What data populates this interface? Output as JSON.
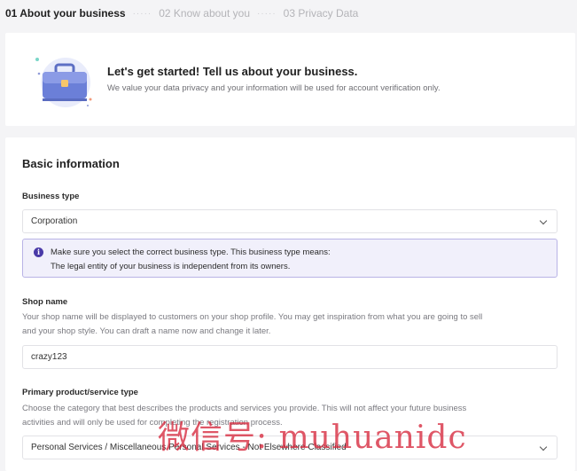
{
  "stepper": {
    "steps": [
      {
        "label": "01 About your business"
      },
      {
        "label": "02 Know about you"
      },
      {
        "label": "03 Privacy Data"
      }
    ],
    "separator": "·····"
  },
  "intro": {
    "title": "Let's get started! Tell us about your business.",
    "subtitle": "We value your data privacy and your information will be used for account verification only.",
    "illustration": "briefcase-icon"
  },
  "form": {
    "section_title": "Basic information",
    "business_type": {
      "label": "Business type",
      "value": "Corporation"
    },
    "notice": {
      "line1": "Make sure you select the correct business type. This business type means:",
      "line2": "The legal entity of your business is independent from its owners.",
      "icon": "info-icon"
    },
    "shop_name": {
      "label": "Shop name",
      "help_line1": "Your shop name will be displayed to customers on your shop profile. You may get inspiration from what you are going to sell",
      "help_line2": "and your shop style. You can draft a name now and change it later.",
      "value": "crazy123"
    },
    "product_type": {
      "label": "Primary product/service type",
      "help_line1": "Choose the category that best describes the products and services you provide. This will not affect your future business",
      "help_line2": "activities and will only be used for completing the registration process.",
      "value": "Personal Services / Miscellaneous Personal Services - Not Elsewhere Classified"
    }
  },
  "watermark": "微信号: muhuanidc",
  "colors": {
    "accent": "#4a3aa8",
    "notice_bg": "#f1f0fb",
    "notice_border": "#b9b3e6"
  }
}
